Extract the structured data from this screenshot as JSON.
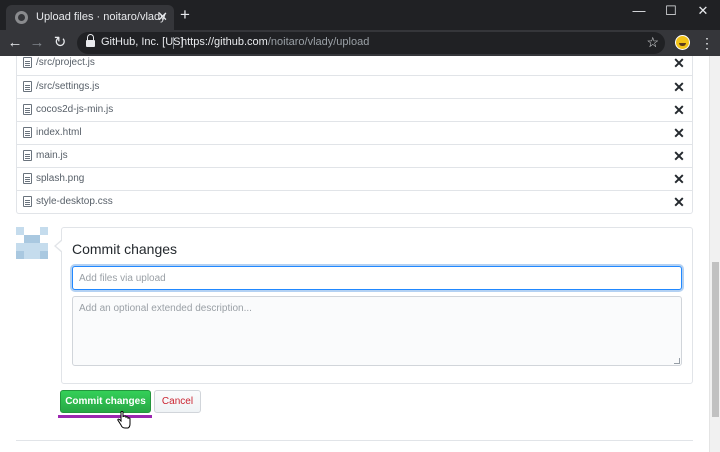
{
  "browser": {
    "tab_title": "Upload files · noitaro/vlady",
    "tab_close": "✕",
    "new_tab": "+",
    "window": {
      "minimize": "—",
      "maximize": "☐",
      "close": "✕"
    },
    "nav": {
      "back": "←",
      "forward": "→",
      "reload": "↻"
    },
    "site_identity": "GitHub, Inc. [US]",
    "url_host": "https://github.com",
    "url_path": "/noitaro/vlady/upload",
    "bookmark_star": "☆",
    "menu": "⋮",
    "icons": [
      "github-favicon",
      "lock-icon",
      "star-icon",
      "profile-icon",
      "menu-icon"
    ]
  },
  "files": [
    {
      "name": "/src/project.js",
      "remove": "✕"
    },
    {
      "name": "/src/settings.js",
      "remove": "✕"
    },
    {
      "name": "cocos2d-js-min.js",
      "remove": "✕"
    },
    {
      "name": "index.html",
      "remove": "✕"
    },
    {
      "name": "main.js",
      "remove": "✕"
    },
    {
      "name": "splash.png",
      "remove": "✕"
    },
    {
      "name": "style-desktop.css",
      "remove": "✕"
    }
  ],
  "commit": {
    "heading": "Commit changes",
    "summary_placeholder": "Add files via upload",
    "description_placeholder": "Add an optional extended description...",
    "commit_button": "Commit changes",
    "cancel_button": "Cancel"
  },
  "colors": {
    "commit_button": "#28a745",
    "cancel_text": "#cb2431",
    "highlight_underline": "#9c27b0",
    "input_focus": "#2188ff"
  }
}
